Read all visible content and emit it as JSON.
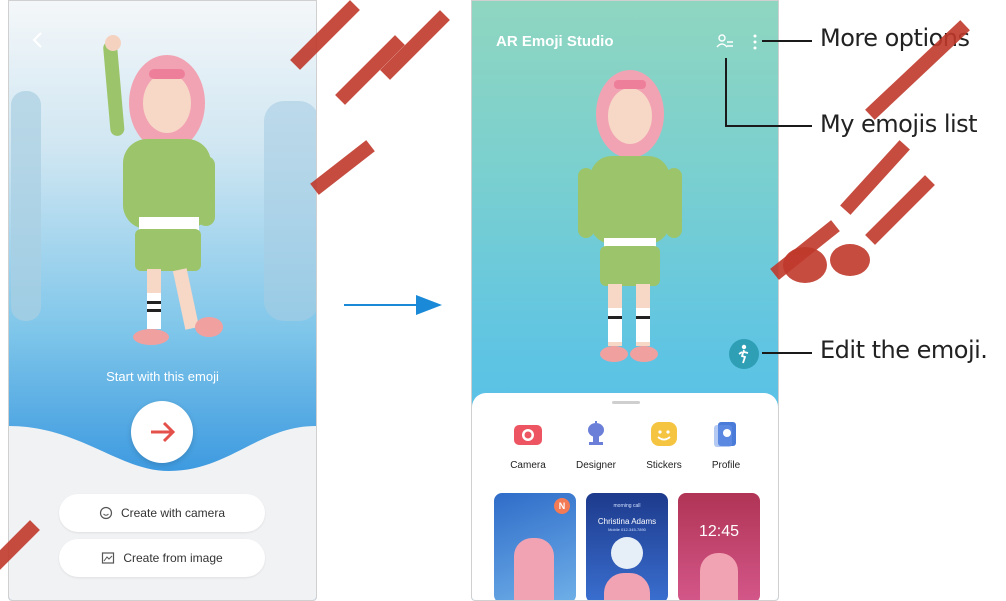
{
  "left_screen": {
    "start_text": "Start with this emoji",
    "create_camera": "Create with camera",
    "create_image": "Create from image"
  },
  "right_screen": {
    "title": "AR Emoji Studio",
    "menu": [
      {
        "label": "Camera"
      },
      {
        "label": "Designer"
      },
      {
        "label": "Stickers"
      },
      {
        "label": "Profile"
      }
    ],
    "card2": {
      "small": "morning call",
      "name": "Christina Adams",
      "sub": "Mobile 012-345-7890"
    },
    "card3": {
      "time": "12:45"
    },
    "badge": "N"
  },
  "callouts": {
    "more_options": "More options",
    "my_emojis_list": "My emojis list",
    "edit_emoji": "Edit the emoji."
  },
  "colors": {
    "accent_red": "#e4504a",
    "arrow_blue": "#1a8ad8",
    "watermark": "#c0392b"
  }
}
